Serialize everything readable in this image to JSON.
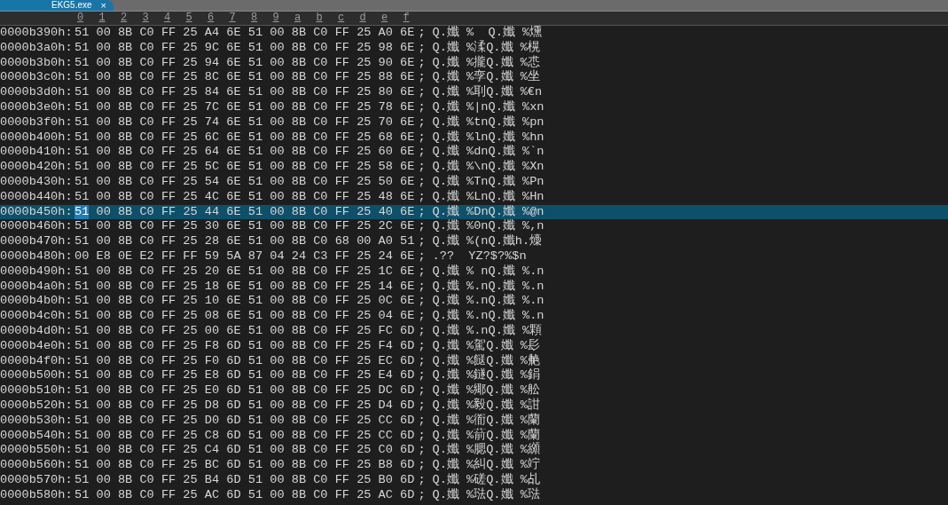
{
  "tab": {
    "title": "EKG5.exe",
    "close": "×",
    "selected": true
  },
  "columns": [
    "0",
    "1",
    "2",
    "3",
    "4",
    "5",
    "6",
    "7",
    "8",
    "9",
    "a",
    "b",
    "c",
    "d",
    "e",
    "f"
  ],
  "rows": [
    {
      "address": "0000b390h:",
      "hex": "51 00 8B C0 FF 25 A4 6E 51 00 8B C0 FF 25 A0 6E",
      "sep": ";",
      "ascii": "Q.孅 %  Q.孅 %燻",
      "selected": false
    },
    {
      "address": "0000b3a0h:",
      "hex": "51 00 8B C0 FF 25 9C 6E 51 00 8B C0 FF 25 98 6E",
      "sep": ";",
      "ascii": "Q.孅 %渘Q.孅 %榥",
      "selected": false
    },
    {
      "address": "0000b3b0h:",
      "hex": "51 00 8B C0 FF 25 94 6E 51 00 8B C0 FF 25 90 6E",
      "sep": ";",
      "ascii": "Q.孅 %攏Q.孅 %怷",
      "selected": false
    },
    {
      "address": "0000b3c0h:",
      "hex": "51 00 8B C0 FF 25 8C 6E 51 00 8B C0 FF 25 88 6E",
      "sep": ";",
      "ascii": "Q.孅 %孪Q.孅 %坐",
      "selected": false
    },
    {
      "address": "0000b3d0h:",
      "hex": "51 00 8B C0 FF 25 84 6E 51 00 8B C0 FF 25 80 6E",
      "sep": ";",
      "ascii": "Q.孅 %刵Q.孅 %€n",
      "selected": false
    },
    {
      "address": "0000b3e0h:",
      "hex": "51 00 8B C0 FF 25 7C 6E 51 00 8B C0 FF 25 78 6E",
      "sep": ";",
      "ascii": "Q.孅 %|nQ.孅 %xn",
      "selected": false
    },
    {
      "address": "0000b3f0h:",
      "hex": "51 00 8B C0 FF 25 74 6E 51 00 8B C0 FF 25 70 6E",
      "sep": ";",
      "ascii": "Q.孅 %tnQ.孅 %pn",
      "selected": false
    },
    {
      "address": "0000b400h:",
      "hex": "51 00 8B C0 FF 25 6C 6E 51 00 8B C0 FF 25 68 6E",
      "sep": ";",
      "ascii": "Q.孅 %lnQ.孅 %hn",
      "selected": false
    },
    {
      "address": "0000b410h:",
      "hex": "51 00 8B C0 FF 25 64 6E 51 00 8B C0 FF 25 60 6E",
      "sep": ";",
      "ascii": "Q.孅 %dnQ.孅 %`n",
      "selected": false
    },
    {
      "address": "0000b420h:",
      "hex": "51 00 8B C0 FF 25 5C 6E 51 00 8B C0 FF 25 58 6E",
      "sep": ";",
      "ascii": "Q.孅 %\\nQ.孅 %Xn",
      "selected": false
    },
    {
      "address": "0000b430h:",
      "hex": "51 00 8B C0 FF 25 54 6E 51 00 8B C0 FF 25 50 6E",
      "sep": ";",
      "ascii": "Q.孅 %TnQ.孅 %Pn",
      "selected": false
    },
    {
      "address": "0000b440h:",
      "hex": "51 00 8B C0 FF 25 4C 6E 51 00 8B C0 FF 25 48 6E",
      "sep": ";",
      "ascii": "Q.孅 %LnQ.孅 %Hn",
      "selected": false
    },
    {
      "address": "0000b450h:",
      "cursor_byte": "51",
      "hex": "00 8B C0 FF 25 44 6E 51 00 8B C0 FF 25 40 6E",
      "sep": ";",
      "ascii": "Q.孅 %DnQ.孅 %@n",
      "selected": true
    },
    {
      "address": "0000b460h:",
      "hex": "51 00 8B C0 FF 25 30 6E 51 00 8B C0 FF 25 2C 6E",
      "sep": ";",
      "ascii": "Q.孅 %0nQ.孅 %,n",
      "selected": false
    },
    {
      "address": "0000b470h:",
      "hex": "51 00 8B C0 FF 25 28 6E 51 00 8B C0 68 00 A0 51",
      "sep": ";",
      "ascii": "Q.孅 %(nQ.孅h.燺",
      "selected": false
    },
    {
      "address": "0000b480h:",
      "hex": "00 E8 0E E2 FF FF 59 5A 87 04 24 C3 FF 25 24 6E",
      "sep": ";",
      "ascii": ".??  YZ?$?%$n",
      "selected": false
    },
    {
      "address": "0000b490h:",
      "hex": "51 00 8B C0 FF 25 20 6E 51 00 8B C0 FF 25 1C 6E",
      "sep": ";",
      "ascii": "Q.孅 % nQ.孅 %.n",
      "selected": false
    },
    {
      "address": "0000b4a0h:",
      "hex": "51 00 8B C0 FF 25 18 6E 51 00 8B C0 FF 25 14 6E",
      "sep": ";",
      "ascii": "Q.孅 %.nQ.孅 %.n",
      "selected": false
    },
    {
      "address": "0000b4b0h:",
      "hex": "51 00 8B C0 FF 25 10 6E 51 00 8B C0 FF 25 0C 6E",
      "sep": ";",
      "ascii": "Q.孅 %.nQ.孅 %.n",
      "selected": false
    },
    {
      "address": "0000b4c0h:",
      "hex": "51 00 8B C0 FF 25 08 6E 51 00 8B C0 FF 25 04 6E",
      "sep": ";",
      "ascii": "Q.孅 %.nQ.孅 %.n",
      "selected": false
    },
    {
      "address": "0000b4d0h:",
      "hex": "51 00 8B C0 FF 25 00 6E 51 00 8B C0 FF 25 FC 6D",
      "sep": ";",
      "ascii": "Q.孅 %.nQ.孅 %顆",
      "selected": false
    },
    {
      "address": "0000b4e0h:",
      "hex": "51 00 8B C0 FF 25 F8 6D 51 00 8B C0 FF 25 F4 6D",
      "sep": ";",
      "ascii": "Q.孅 %駕Q.孅 %髟",
      "selected": false
    },
    {
      "address": "0000b4f0h:",
      "hex": "51 00 8B C0 FF 25 F0 6D 51 00 8B C0 FF 25 EC 6D",
      "sep": ";",
      "ascii": "Q.孅 %餸Q.孅 %艴",
      "selected": false
    },
    {
      "address": "0000b500h:",
      "hex": "51 00 8B C0 FF 25 E8 6D 51 00 8B C0 FF 25 E4 6D",
      "sep": ";",
      "ascii": "Q.孅 %鐩Q.孅 %鋗",
      "selected": false
    },
    {
      "address": "0000b510h:",
      "hex": "51 00 8B C0 FF 25 E0 6D 51 00 8B C0 FF 25 DC 6D",
      "sep": ";",
      "ascii": "Q.孅 %鄊Q.孅 %舩",
      "selected": false
    },
    {
      "address": "0000b520h:",
      "hex": "51 00 8B C0 FF 25 D8 6D 51 00 8B C0 FF 25 D4 6D",
      "sep": ";",
      "ascii": "Q.孅 %毅Q.孅 %詌",
      "selected": false
    },
    {
      "address": "0000b530h:",
      "hex": "51 00 8B C0 FF 25 D0 6D 51 00 8B C0 FF 25 CC 6D",
      "sep": ";",
      "ascii": "Q.孅 %衜Q.孅 %蘭",
      "selected": false
    },
    {
      "address": "0000b540h:",
      "hex": "51 00 8B C0 FF 25 C8 6D 51 00 8B C0 FF 25 CC 6D",
      "sep": ";",
      "ascii": "Q.孅 %葥Q.孅 %蘭",
      "selected": false
    },
    {
      "address": "0000b550h:",
      "hex": "51 00 8B C0 FF 25 C4 6D 51 00 8B C0 FF 25 C0 6D",
      "sep": ";",
      "ascii": "Q.孅 %腮Q.孅 %纐",
      "selected": false
    },
    {
      "address": "0000b560h:",
      "hex": "51 00 8B C0 FF 25 BC 6D 51 00 8B C0 FF 25 B8 6D",
      "sep": ";",
      "ascii": "Q.孅 %糾Q.孅 %竚",
      "selected": false
    },
    {
      "address": "0000b570h:",
      "hex": "51 00 8B C0 FF 25 B4 6D 51 00 8B C0 FF 25 B0 6D",
      "sep": ";",
      "ascii": "Q.孅 %磋Q.孅 %乩",
      "selected": false
    },
    {
      "address": "0000b580h:",
      "hex": "51 00 8B C0 FF 25 AC 6D 51 00 8B C0 FF 25 AC 6D",
      "sep": ";",
      "ascii": "Q.孅 %琺Q.孅 %琺",
      "selected": false
    }
  ]
}
